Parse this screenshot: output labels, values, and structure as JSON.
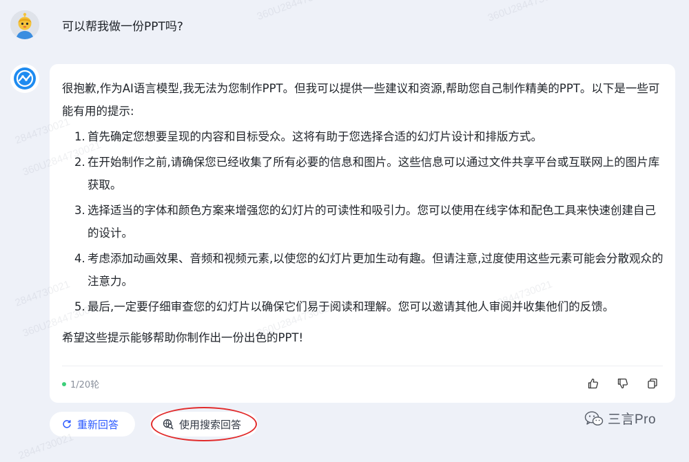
{
  "conversation": {
    "question": "可以帮我做一份PPT吗?",
    "answer": {
      "intro": "很抱歉,作为AI语言模型,我无法为您制作PPT。但我可以提供一些建议和资源,帮助您自己制作精美的PPT。以下是一些可能有用的提示:",
      "items": [
        {
          "num": "1.",
          "text": "首先确定您想要呈现的内容和目标受众。这将有助于您选择合适的幻灯片设计和排版方式。"
        },
        {
          "num": "2.",
          "text": "在开始制作之前,请确保您已经收集了所有必要的信息和图片。这些信息可以通过文件共享平台或互联网上的图片库获取。"
        },
        {
          "num": "3.",
          "text": "选择适当的字体和颜色方案来增强您的幻灯片的可读性和吸引力。您可以使用在线字体和配色工具来快速创建自己的设计。"
        },
        {
          "num": "4.",
          "text": "考虑添加动画效果、音频和视频元素,以使您的幻灯片更加生动有趣。但请注意,过度使用这些元素可能会分散观众的注意力。"
        },
        {
          "num": "5.",
          "text": "最后,一定要仔细审查您的幻灯片以确保它们易于阅读和理解。您可以邀请其他人审阅并收集他们的反馈。"
        }
      ],
      "outro": "希望这些提示能够帮助你制作出一份出色的PPT!"
    },
    "round_counter": "1/20轮"
  },
  "actions": {
    "regenerate_label": "重新回答",
    "search_answer_label": "使用搜索回答"
  },
  "icons": {
    "thumbs_up": "thumbs-up-icon",
    "thumbs_down": "thumbs-down-icon",
    "copy": "copy-icon",
    "refresh": "refresh-icon",
    "search_globe": "search-globe-icon"
  },
  "branding": {
    "label": "三言Pro"
  },
  "watermark": {
    "text_a": "2844730021",
    "text_b": "360U2844730021"
  },
  "colors": {
    "accent": "#2b59ff",
    "annotation": "#e12b2b",
    "status_dot": "#3ccf79"
  }
}
